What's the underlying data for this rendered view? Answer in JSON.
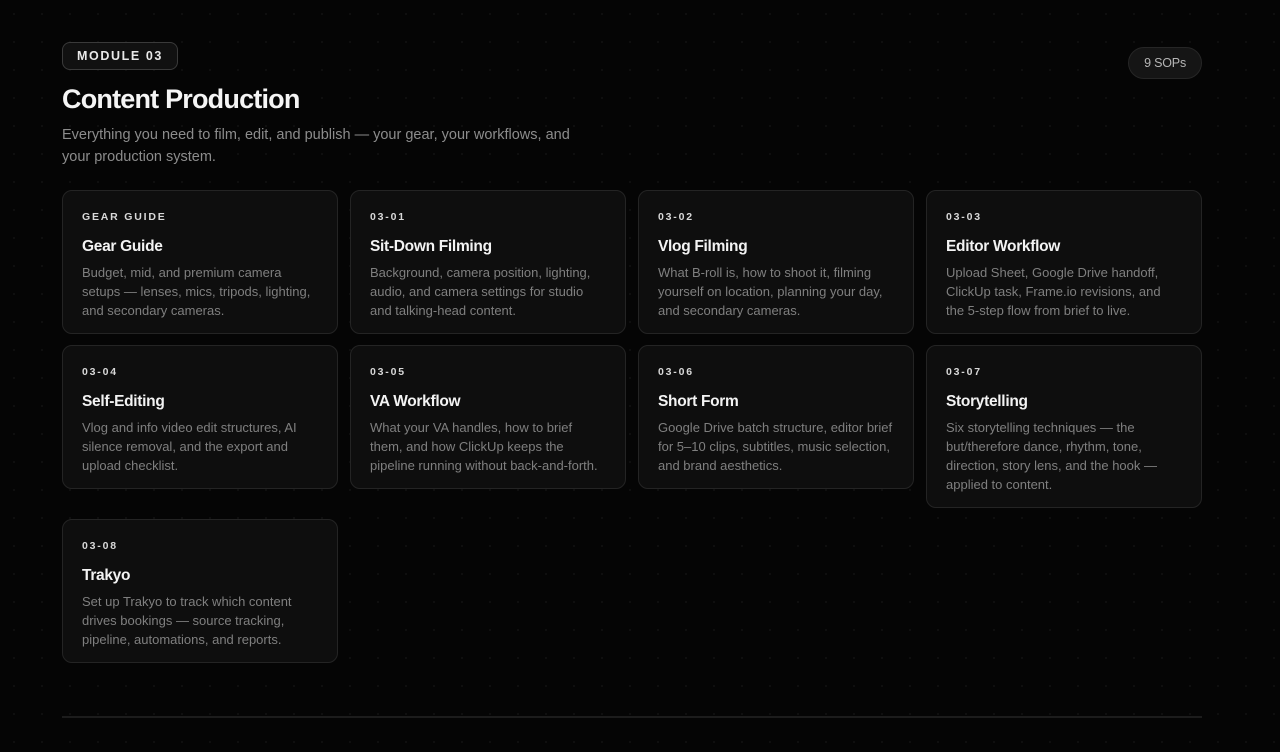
{
  "header": {
    "module_label": "MODULE 03",
    "sop_count": "9 SOPs",
    "title": "Content Production",
    "description": "Everything you need to film, edit, and publish — your gear, your workflows, and your production system."
  },
  "cards": [
    {
      "code": "GEAR GUIDE",
      "title": "Gear Guide",
      "description": "Budget, mid, and premium camera setups — lenses, mics, tripods, lighting, and secondary cameras."
    },
    {
      "code": "03-01",
      "title": "Sit-Down Filming",
      "description": "Background, camera position, lighting, audio, and camera settings for studio and talking-head content."
    },
    {
      "code": "03-02",
      "title": "Vlog Filming",
      "description": "What B-roll is, how to shoot it, filming yourself on location, planning your day, and secondary cameras."
    },
    {
      "code": "03-03",
      "title": "Editor Workflow",
      "description": "Upload Sheet, Google Drive handoff, ClickUp task, Frame.io revisions, and the 5-step flow from brief to live."
    },
    {
      "code": "03-04",
      "title": "Self-Editing",
      "description": "Vlog and info video edit structures, AI silence removal, and the export and upload checklist."
    },
    {
      "code": "03-05",
      "title": "VA Workflow",
      "description": "What your VA handles, how to brief them, and how ClickUp keeps the pipeline running without back-and-forth."
    },
    {
      "code": "03-06",
      "title": "Short Form",
      "description": "Google Drive batch structure, editor brief for 5–10 clips, subtitles, music selection, and brand aesthetics."
    },
    {
      "code": "03-07",
      "title": "Storytelling",
      "description": "Six storytelling techniques — the but/therefore dance, rhythm, tone, direction, story lens, and the hook — applied to content."
    },
    {
      "code": "03-08",
      "title": "Trakyo",
      "description": "Set up Trakyo to track which content drives bookings — source tracking, pipeline, automations, and reports."
    }
  ]
}
